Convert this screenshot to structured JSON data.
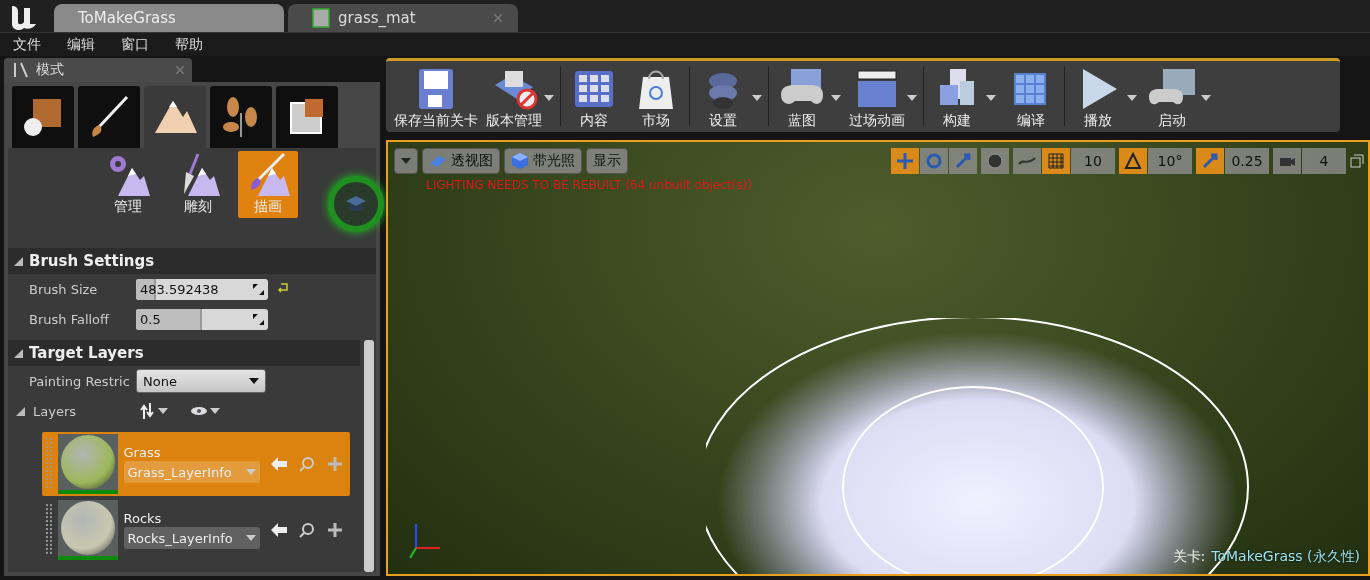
{
  "tabs": [
    {
      "label": "ToMakeGrass",
      "selected": true,
      "kind": "level"
    },
    {
      "label": "grass_mat",
      "selected": false,
      "kind": "material"
    }
  ],
  "menu": [
    "文件",
    "编辑",
    "窗口",
    "帮助"
  ],
  "modes_panel": {
    "title": "模式",
    "mode_tabs": [
      {
        "kind": "place",
        "selected": false
      },
      {
        "kind": "paint",
        "selected": false
      },
      {
        "kind": "landscape",
        "selected": true
      },
      {
        "kind": "foliage",
        "selected": false
      },
      {
        "kind": "geometry",
        "selected": false
      }
    ],
    "tools": [
      {
        "label": "管理",
        "kind": "manage",
        "selected": false
      },
      {
        "label": "雕刻",
        "kind": "sculpt",
        "selected": false
      },
      {
        "label": "描画",
        "kind": "paint",
        "selected": true
      }
    ],
    "brush_settings": {
      "title": "Brush Settings",
      "properties": [
        {
          "label": "Brush Size",
          "value": "483.592438",
          "level": 0.15,
          "modified": true
        },
        {
          "label": "Brush Falloff",
          "value": "0.5",
          "level": 0.5,
          "modified": false
        }
      ]
    },
    "target_layers": {
      "title": "Target Layers",
      "painting_restriction": {
        "label": "Painting Restric",
        "value": "None"
      },
      "layers_label": "Layers",
      "layers": [
        {
          "name": "Grass",
          "info": "Grass_LayerInfo",
          "selected": true,
          "kind": "grass"
        },
        {
          "name": "Rocks",
          "info": "Rocks_LayerInfo",
          "selected": false,
          "kind": "rocks"
        }
      ]
    }
  },
  "toolbar": [
    {
      "label": "保存当前关卡",
      "kind": "save",
      "menu": false
    },
    {
      "label": "版本管理",
      "kind": "source",
      "menu": true
    },
    {
      "label": "内容",
      "kind": "content",
      "menu": false
    },
    {
      "label": "市场",
      "kind": "market",
      "menu": false
    },
    {
      "label": "设置",
      "kind": "settings",
      "menu": true
    },
    {
      "label": "蓝图",
      "kind": "blueprint",
      "menu": true
    },
    {
      "label": "过场动画",
      "kind": "cinematic",
      "menu": true
    },
    {
      "label": "构建",
      "kind": "build",
      "menu": true
    },
    {
      "label": "编译",
      "kind": "compile",
      "menu": false
    },
    {
      "label": "播放",
      "kind": "play",
      "menu": true
    },
    {
      "label": "启动",
      "kind": "launch",
      "menu": true
    }
  ],
  "viewport": {
    "buttons": [
      {
        "label": "透视图",
        "kind": "perspective"
      },
      {
        "label": "带光照",
        "kind": "lit"
      },
      {
        "label": "显示",
        "kind": "show"
      }
    ],
    "transform_modes": [
      {
        "kind": "translate",
        "selected": true
      },
      {
        "kind": "rotate",
        "selected": false
      },
      {
        "kind": "scale",
        "selected": false
      }
    ],
    "snaps": [
      {
        "kind": "grid",
        "value": "10",
        "on": true
      },
      {
        "kind": "rotation",
        "value": "10°",
        "on": true
      },
      {
        "kind": "scale",
        "value": "0.25",
        "on": true
      },
      {
        "kind": "camera",
        "value": "4",
        "on": false
      }
    ],
    "warning": "LIGHTING NEEDS TO BE REBUILT (64 unbuilt object(s))",
    "level_label": "关卡:",
    "level_name": "ToMakeGrass (永久性)"
  }
}
